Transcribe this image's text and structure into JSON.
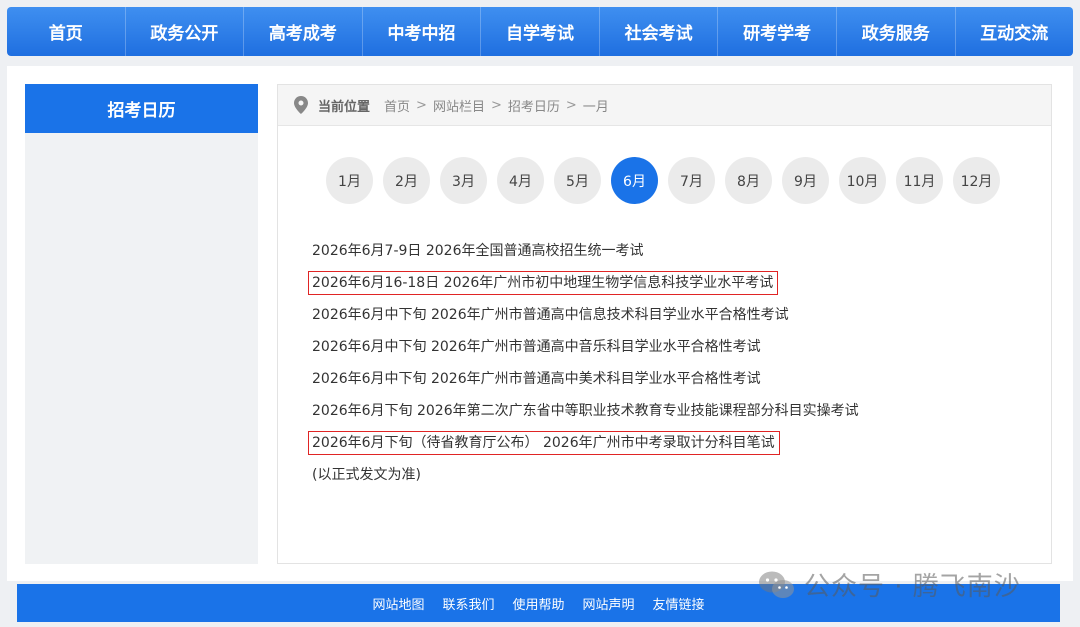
{
  "nav": [
    "首页",
    "政务公开",
    "高考成考",
    "中考中招",
    "自学考试",
    "社会考试",
    "研考学考",
    "政务服务",
    "互动交流"
  ],
  "sidebar": {
    "title": "招考日历"
  },
  "breadcrumb": {
    "label": "当前位置",
    "items": [
      "首页",
      "网站栏目",
      "招考日历",
      "一月"
    ],
    "sep": ">"
  },
  "months": [
    "1月",
    "2月",
    "3月",
    "4月",
    "5月",
    "6月",
    "7月",
    "8月",
    "9月",
    "10月",
    "11月",
    "12月"
  ],
  "active_month_index": 5,
  "events": [
    {
      "text": "2026年6月7-9日 2026年全国普通高校招生统一考试",
      "highlight": false
    },
    {
      "text": "2026年6月16-18日 2026年广州市初中地理生物学信息科技学业水平考试",
      "highlight": true
    },
    {
      "text": "2026年6月中下旬 2026年广州市普通高中信息技术科目学业水平合格性考试",
      "highlight": false
    },
    {
      "text": "2026年6月中下旬 2026年广州市普通高中音乐科目学业水平合格性考试",
      "highlight": false
    },
    {
      "text": "2026年6月中下旬 2026年广州市普通高中美术科目学业水平合格性考试",
      "highlight": false
    },
    {
      "text": "2026年6月下旬 2026年第二次广东省中等职业技术教育专业技能课程部分科目实操考试",
      "highlight": false
    },
    {
      "text": "2026年6月下旬（待省教育厅公布） 2026年广州市中考录取计分科目笔试",
      "highlight": true
    },
    {
      "text": "(以正式发文为准)",
      "highlight": false
    }
  ],
  "footer": [
    "网站地图",
    "联系我们",
    "使用帮助",
    "网站声明",
    "友情链接"
  ],
  "watermark": "公众号 · 腾飞南沙",
  "colors": {
    "primary": "#1a73e8",
    "highlight": "#e02424"
  }
}
